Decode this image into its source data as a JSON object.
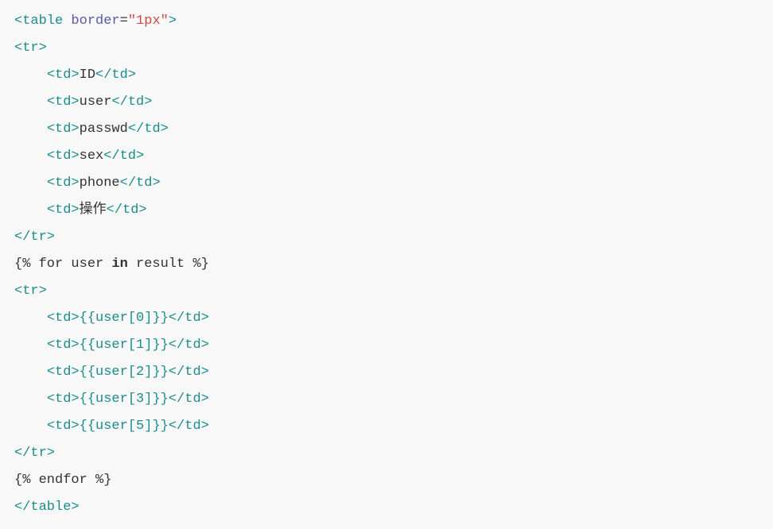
{
  "lines": [
    {
      "indent": 0,
      "parts": [
        {
          "t": "tag",
          "v": "<table"
        },
        {
          "t": "text",
          "v": " "
        },
        {
          "t": "attr-name",
          "v": "border"
        },
        {
          "t": "eq",
          "v": "="
        },
        {
          "t": "attr-value",
          "v": "\"1px\""
        },
        {
          "t": "tag",
          "v": ">"
        }
      ]
    },
    {
      "indent": 0,
      "parts": [
        {
          "t": "tag",
          "v": "<tr>"
        }
      ]
    },
    {
      "indent": 1,
      "parts": [
        {
          "t": "tag",
          "v": "<td>"
        },
        {
          "t": "text",
          "v": "ID"
        },
        {
          "t": "tag",
          "v": "</td>"
        }
      ]
    },
    {
      "indent": 1,
      "parts": [
        {
          "t": "tag",
          "v": "<td>"
        },
        {
          "t": "text",
          "v": "user"
        },
        {
          "t": "tag",
          "v": "</td>"
        }
      ]
    },
    {
      "indent": 1,
      "parts": [
        {
          "t": "tag",
          "v": "<td>"
        },
        {
          "t": "text",
          "v": "passwd"
        },
        {
          "t": "tag",
          "v": "</td>"
        }
      ]
    },
    {
      "indent": 1,
      "parts": [
        {
          "t": "tag",
          "v": "<td>"
        },
        {
          "t": "text",
          "v": "sex"
        },
        {
          "t": "tag",
          "v": "</td>"
        }
      ]
    },
    {
      "indent": 1,
      "parts": [
        {
          "t": "tag",
          "v": "<td>"
        },
        {
          "t": "text",
          "v": "phone"
        },
        {
          "t": "tag",
          "v": "</td>"
        }
      ]
    },
    {
      "indent": 1,
      "parts": [
        {
          "t": "tag",
          "v": "<td>"
        },
        {
          "t": "text",
          "v": "操作"
        },
        {
          "t": "tag",
          "v": "</td>"
        }
      ]
    },
    {
      "indent": 0,
      "parts": [
        {
          "t": "tag",
          "v": "</tr>"
        }
      ]
    },
    {
      "indent": 0,
      "parts": [
        {
          "t": "text",
          "v": "{% for user "
        },
        {
          "t": "keyword",
          "v": "in"
        },
        {
          "t": "text",
          "v": " result %}"
        }
      ]
    },
    {
      "indent": 0,
      "parts": [
        {
          "t": "tag",
          "v": "<tr>"
        }
      ]
    },
    {
      "indent": 1,
      "parts": [
        {
          "t": "tag",
          "v": "<td>"
        },
        {
          "t": "template-expr",
          "v": "{{user[0]}}"
        },
        {
          "t": "tag",
          "v": "</td>"
        }
      ]
    },
    {
      "indent": 1,
      "parts": [
        {
          "t": "tag",
          "v": "<td>"
        },
        {
          "t": "template-expr",
          "v": "{{user[1]}}"
        },
        {
          "t": "tag",
          "v": "</td>"
        }
      ]
    },
    {
      "indent": 1,
      "parts": [
        {
          "t": "tag",
          "v": "<td>"
        },
        {
          "t": "template-expr",
          "v": "{{user[2]}}"
        },
        {
          "t": "tag",
          "v": "</td>"
        }
      ]
    },
    {
      "indent": 1,
      "parts": [
        {
          "t": "tag",
          "v": "<td>"
        },
        {
          "t": "template-expr",
          "v": "{{user[3]}}"
        },
        {
          "t": "tag",
          "v": "</td>"
        }
      ]
    },
    {
      "indent": 1,
      "parts": [
        {
          "t": "tag",
          "v": "<td>"
        },
        {
          "t": "template-expr",
          "v": "{{user[5]}}"
        },
        {
          "t": "tag",
          "v": "</td>"
        }
      ]
    },
    {
      "indent": 0,
      "parts": [
        {
          "t": "tag",
          "v": "</tr>"
        }
      ]
    },
    {
      "indent": 0,
      "parts": [
        {
          "t": "text",
          "v": "{% endfor %}"
        }
      ]
    },
    {
      "indent": 0,
      "parts": [
        {
          "t": "tag",
          "v": "</table>"
        }
      ]
    }
  ]
}
